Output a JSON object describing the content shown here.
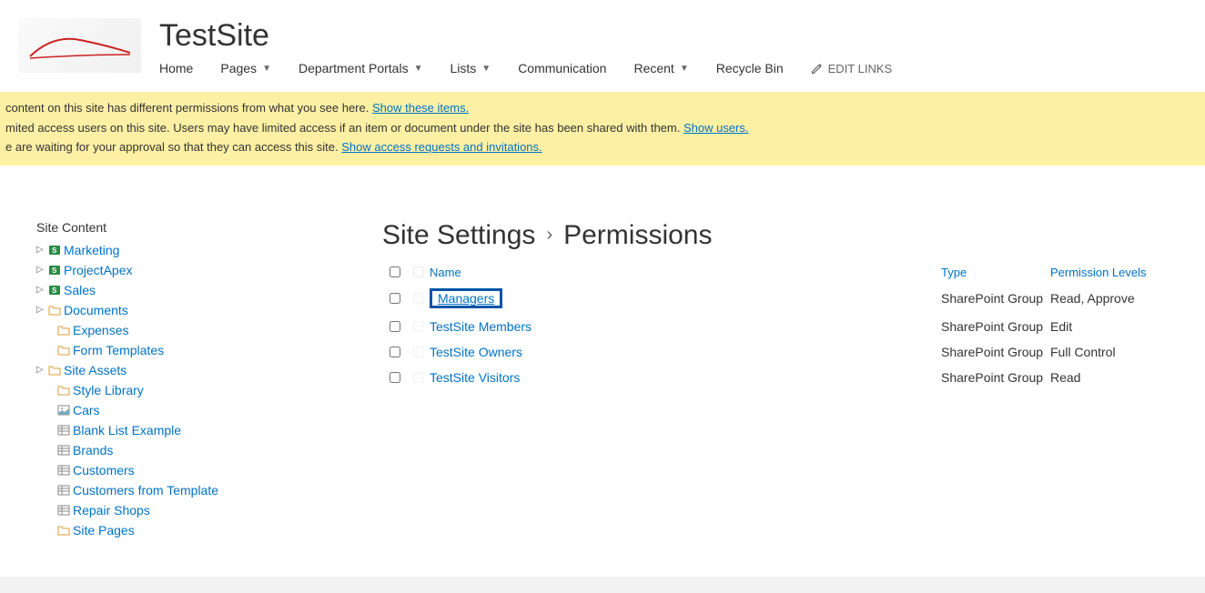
{
  "header": {
    "site_title": "TestSite",
    "nav": {
      "home": "Home",
      "pages": "Pages",
      "department_portals": "Department Portals",
      "lists": "Lists",
      "communication": "Communication",
      "recent": "Recent",
      "recycle_bin": "Recycle Bin",
      "edit_links": "EDIT LINKS"
    }
  },
  "notice": {
    "line1_pre": "content on this site has different permissions from what you see here.  ",
    "line1_link": "Show these items.",
    "line2_pre": "mited access users on this site. Users may have limited access if an item or document under the site has been shared with them. ",
    "line2_link": "Show users.",
    "line3_pre": "e are waiting for your approval so that they can access this site. ",
    "line3_link": "Show access requests and invitations."
  },
  "sidebar": {
    "heading": "Site Content",
    "items": [
      {
        "label": "Marketing",
        "icon": "sp",
        "expander": true
      },
      {
        "label": "ProjectApex",
        "icon": "sp",
        "expander": true
      },
      {
        "label": "Sales",
        "icon": "sp",
        "expander": true
      },
      {
        "label": "Documents",
        "icon": "folder",
        "expander": true
      },
      {
        "label": "Expenses",
        "icon": "folder",
        "expander": false
      },
      {
        "label": "Form Templates",
        "icon": "folder",
        "expander": false
      },
      {
        "label": "Site Assets",
        "icon": "folder",
        "expander": true
      },
      {
        "label": "Style Library",
        "icon": "folder",
        "expander": false
      },
      {
        "label": "Cars",
        "icon": "image",
        "expander": false
      },
      {
        "label": "Blank List Example",
        "icon": "list",
        "expander": false
      },
      {
        "label": "Brands",
        "icon": "list",
        "expander": false
      },
      {
        "label": "Customers",
        "icon": "list",
        "expander": false
      },
      {
        "label": "Customers from Template",
        "icon": "list",
        "expander": false
      },
      {
        "label": "Repair Shops",
        "icon": "list",
        "expander": false
      },
      {
        "label": "Site Pages",
        "icon": "folder",
        "expander": false
      }
    ]
  },
  "main": {
    "breadcrumb": {
      "parent": "Site Settings",
      "current": "Permissions"
    },
    "columns": {
      "name": "Name",
      "type": "Type",
      "perm": "Permission Levels"
    },
    "rows": [
      {
        "name": "Managers",
        "type": "SharePoint Group",
        "perm": "Read, Approve",
        "highlight": true
      },
      {
        "name": "TestSite Members",
        "type": "SharePoint Group",
        "perm": "Edit",
        "highlight": false
      },
      {
        "name": "TestSite Owners",
        "type": "SharePoint Group",
        "perm": "Full Control",
        "highlight": false
      },
      {
        "name": "TestSite Visitors",
        "type": "SharePoint Group",
        "perm": "Read",
        "highlight": false
      }
    ]
  }
}
